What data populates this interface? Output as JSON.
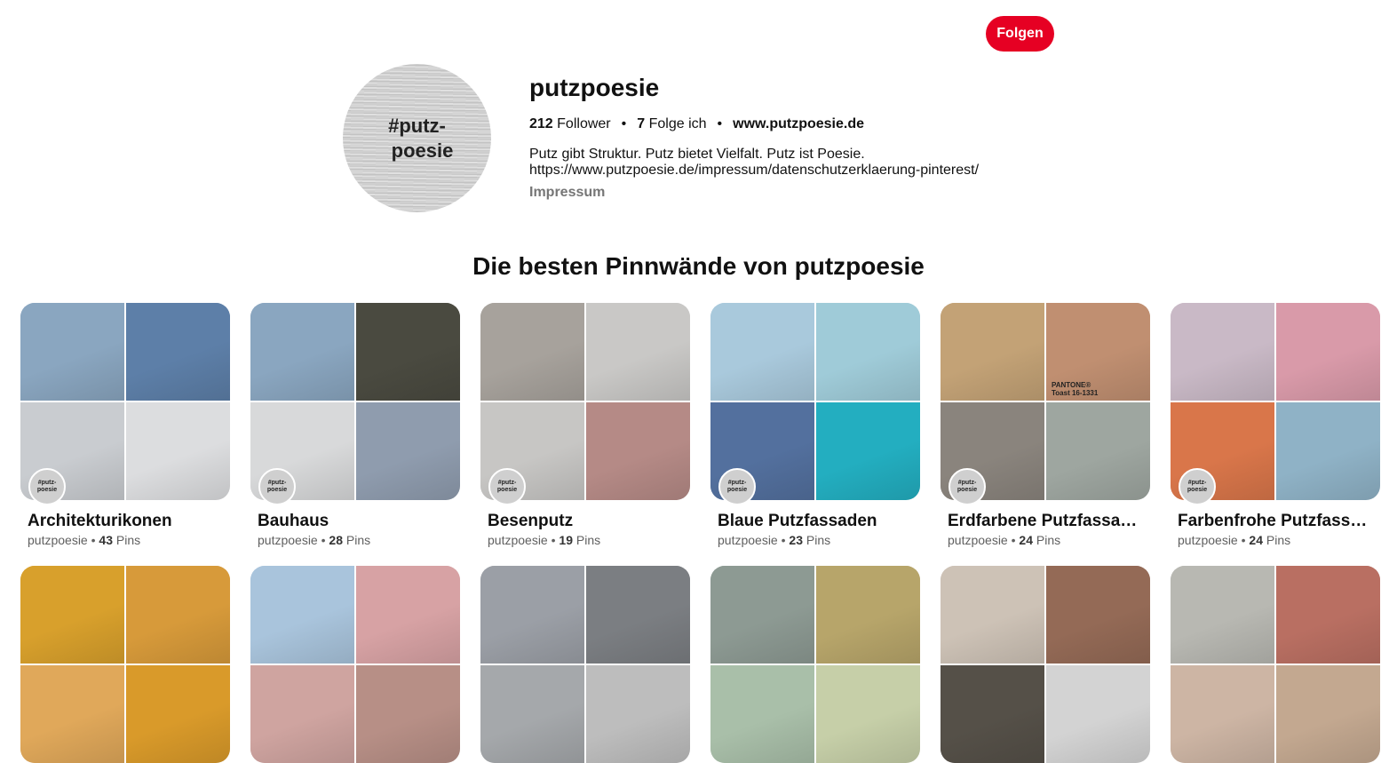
{
  "header": {
    "follow_label": "Folgen"
  },
  "profile": {
    "avatar_line1": "#putz-",
    "avatar_line2": "poesie",
    "name": "putzpoesie",
    "followers_count": "212",
    "followers_label": "Follower",
    "following_count": "7",
    "following_label": "Folge ich",
    "separator": "•",
    "website": "www.putzpoesie.de",
    "bio_line1": "Putz gibt Struktur. Putz bietet Vielfalt. Putz ist Poesie.",
    "bio_line2": "https://www.putzpoesie.de/impressum/datenschutzerklaerung-pinterest/",
    "impressum": "Impressum"
  },
  "section_title": "Die besten Pinnwände von putzpoesie",
  "boards_label_owner": "putzpoesie",
  "pins_label": "Pins",
  "mini_avatar_text": "#putz-poesie",
  "boards": [
    {
      "title": "Architekturikonen",
      "owner": "putzpoesie",
      "count": "43",
      "tiles": [
        "#8aa6c0",
        "#5d7fa8",
        "#c9ccd0",
        "#dcdddf"
      ]
    },
    {
      "title": "Bauhaus",
      "owner": "putzpoesie",
      "count": "28",
      "tiles": [
        "#8aa6c0",
        "#4a4a40",
        "#d8d9da",
        "#8f9cae"
      ]
    },
    {
      "title": "Besenputz",
      "owner": "putzpoesie",
      "count": "19",
      "tiles": [
        "#a7a29c",
        "#c9c8c6",
        "#c7c6c4",
        "#b58a86"
      ]
    },
    {
      "title": "Blaue Putzfassaden",
      "owner": "putzpoesie",
      "count": "23",
      "tiles": [
        "#a9c9dc",
        "#9fcbd8",
        "#53709e",
        "#23aec0"
      ]
    },
    {
      "title": "Erdfarbene Putzfassa…",
      "owner": "putzpoesie",
      "count": "24",
      "tiles": [
        "#c3a276",
        "#c08f71",
        "#8a847d",
        "#9ea6a0"
      ],
      "pantone_line1": "PANTONE®",
      "pantone_line2": "Toast 16-1331"
    },
    {
      "title": "Farbenfrohe Putzfass…",
      "owner": "putzpoesie",
      "count": "24",
      "tiles": [
        "#c9b9c6",
        "#d99aa9",
        "#d9764a",
        "#8fb2c6"
      ]
    },
    {
      "title": "",
      "owner": "",
      "count": "",
      "tiles": [
        "#d8a02c",
        "#d79a3a",
        "#e0a85a",
        "#d99a2a"
      ]
    },
    {
      "title": "",
      "owner": "",
      "count": "",
      "tiles": [
        "#a9c4dc",
        "#d7a2a4",
        "#cfa4a0",
        "#b78f86"
      ]
    },
    {
      "title": "",
      "owner": "",
      "count": "",
      "tiles": [
        "#9b9fa6",
        "#7b7e82",
        "#a5a8ab",
        "#bdbdbd"
      ]
    },
    {
      "title": "",
      "owner": "",
      "count": "",
      "tiles": [
        "#8d9a93",
        "#b7a56a",
        "#a9bfa9",
        "#c6cfa8"
      ]
    },
    {
      "title": "",
      "owner": "",
      "count": "",
      "tiles": [
        "#cdc2b6",
        "#946a56",
        "#555048",
        "#d3d3d3"
      ]
    },
    {
      "title": "",
      "owner": "",
      "count": "",
      "tiles": [
        "#b8b8b2",
        "#b96f62",
        "#cdb5a4",
        "#c3a890"
      ]
    }
  ]
}
